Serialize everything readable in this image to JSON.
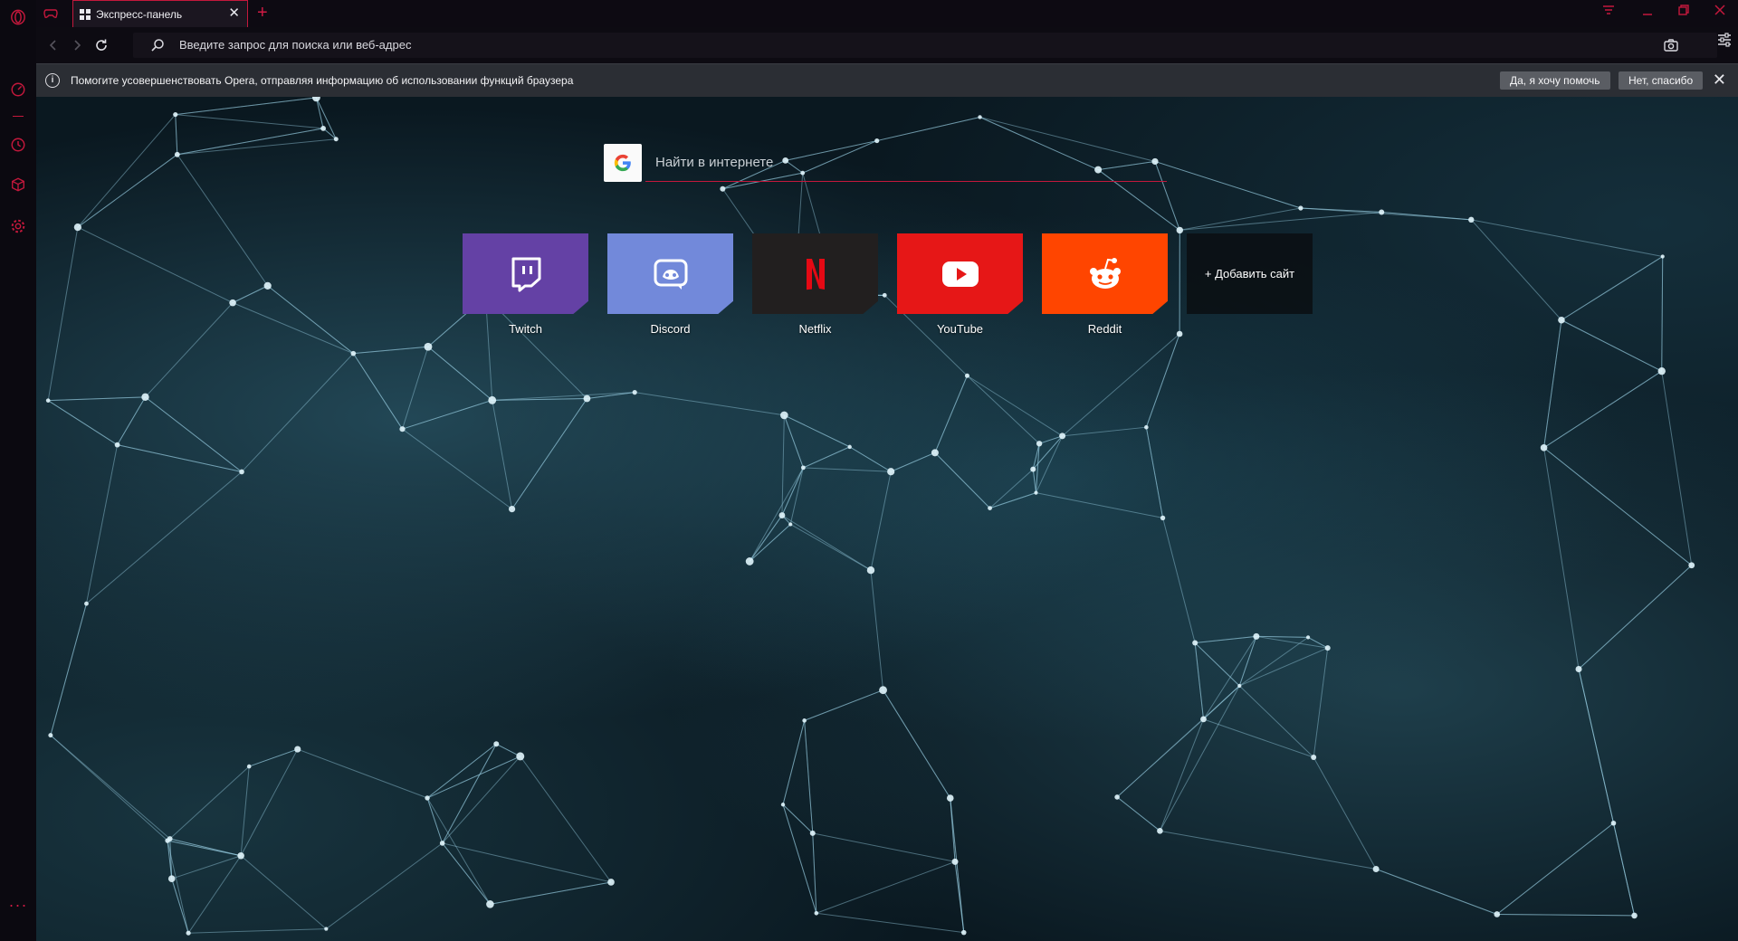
{
  "tabs": [
    {
      "title": "Экспресс-панель",
      "active": true
    }
  ],
  "new_tab_symbol": "+",
  "address_bar": {
    "placeholder": "Введите запрос для поиска или веб-адрес"
  },
  "infobar": {
    "message": "Помогите усовершенствовать Opera, отправляя информацию об использовании функций браузера",
    "accept_label": "Да, я хочу помочь",
    "decline_label": "Нет, спасибо"
  },
  "speed_dial": {
    "search_placeholder": "Найти в интернете",
    "tiles": [
      {
        "label": "Twitch",
        "color": "#6441a5",
        "icon": "twitch-icon"
      },
      {
        "label": "Discord",
        "color": "#7289da",
        "icon": "discord-icon"
      },
      {
        "label": "Netflix",
        "color": "#221f1f",
        "icon": "netflix-icon"
      },
      {
        "label": "YouTube",
        "color": "#e61717",
        "icon": "youtube-icon"
      },
      {
        "label": "Reddit",
        "color": "#ff4500",
        "icon": "reddit-icon"
      }
    ],
    "add_site_label": "+ Добавить сайт"
  },
  "sidebar": {
    "items": [
      "speed-dial-icon",
      "history-icon",
      "extensions-icon",
      "settings-icon"
    ],
    "more_symbol": "···"
  },
  "theme": {
    "accent": "#d01a44"
  }
}
